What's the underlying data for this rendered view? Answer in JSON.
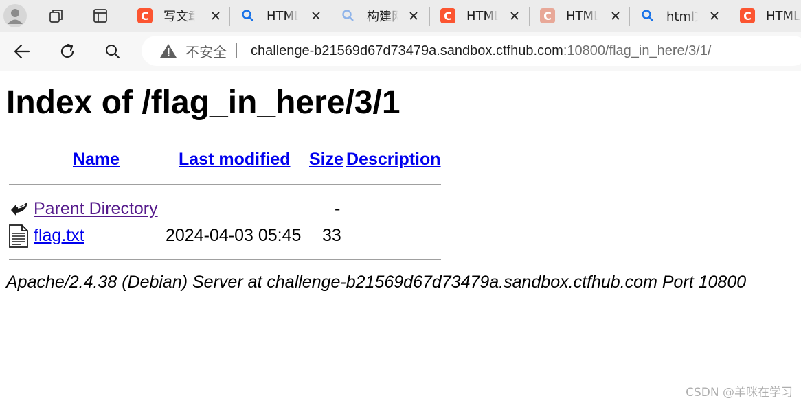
{
  "browser": {
    "tabs": [
      {
        "favicon": "csdn-c-icon",
        "title": "写文章"
      },
      {
        "favicon": "search-icon",
        "title": "HTML"
      },
      {
        "favicon": "search-icon",
        "title": "构建网"
      },
      {
        "favicon": "csdn-c-icon",
        "title": "HTML"
      },
      {
        "favicon": "csdn-c-icon",
        "title": "HTML"
      },
      {
        "favicon": "search-icon",
        "title": "html文"
      },
      {
        "favicon": "csdn-c-icon",
        "title": "HTML"
      }
    ],
    "security_label": "不安全",
    "url_host": "challenge-b21569d67d73479a.sandbox.ctfhub.com",
    "url_rest": ":10800/flag_in_here/3/1/"
  },
  "page": {
    "heading": "Index of /flag_in_here/3/1",
    "columns": {
      "name": "Name",
      "last_modified": "Last modified",
      "size": "Size",
      "description": "Description"
    },
    "entries": [
      {
        "icon": "back-arrow-icon",
        "name": "Parent Directory",
        "modified": "",
        "size": "-",
        "description": ""
      },
      {
        "icon": "text-file-icon",
        "name": "flag.txt",
        "modified": "2024-04-03 05:45",
        "size": "33",
        "description": ""
      }
    ],
    "server_signature": "Apache/2.4.38 (Debian) Server at challenge-b21569d67d73479a.sandbox.ctfhub.com Port 10800"
  },
  "watermark": "CSDN @羊咪在学习",
  "colors": {
    "link": "#0000ee",
    "visited_link": "#551a8b",
    "csdn_brand": "#fc5531",
    "search_icon": "#1a73e8"
  }
}
